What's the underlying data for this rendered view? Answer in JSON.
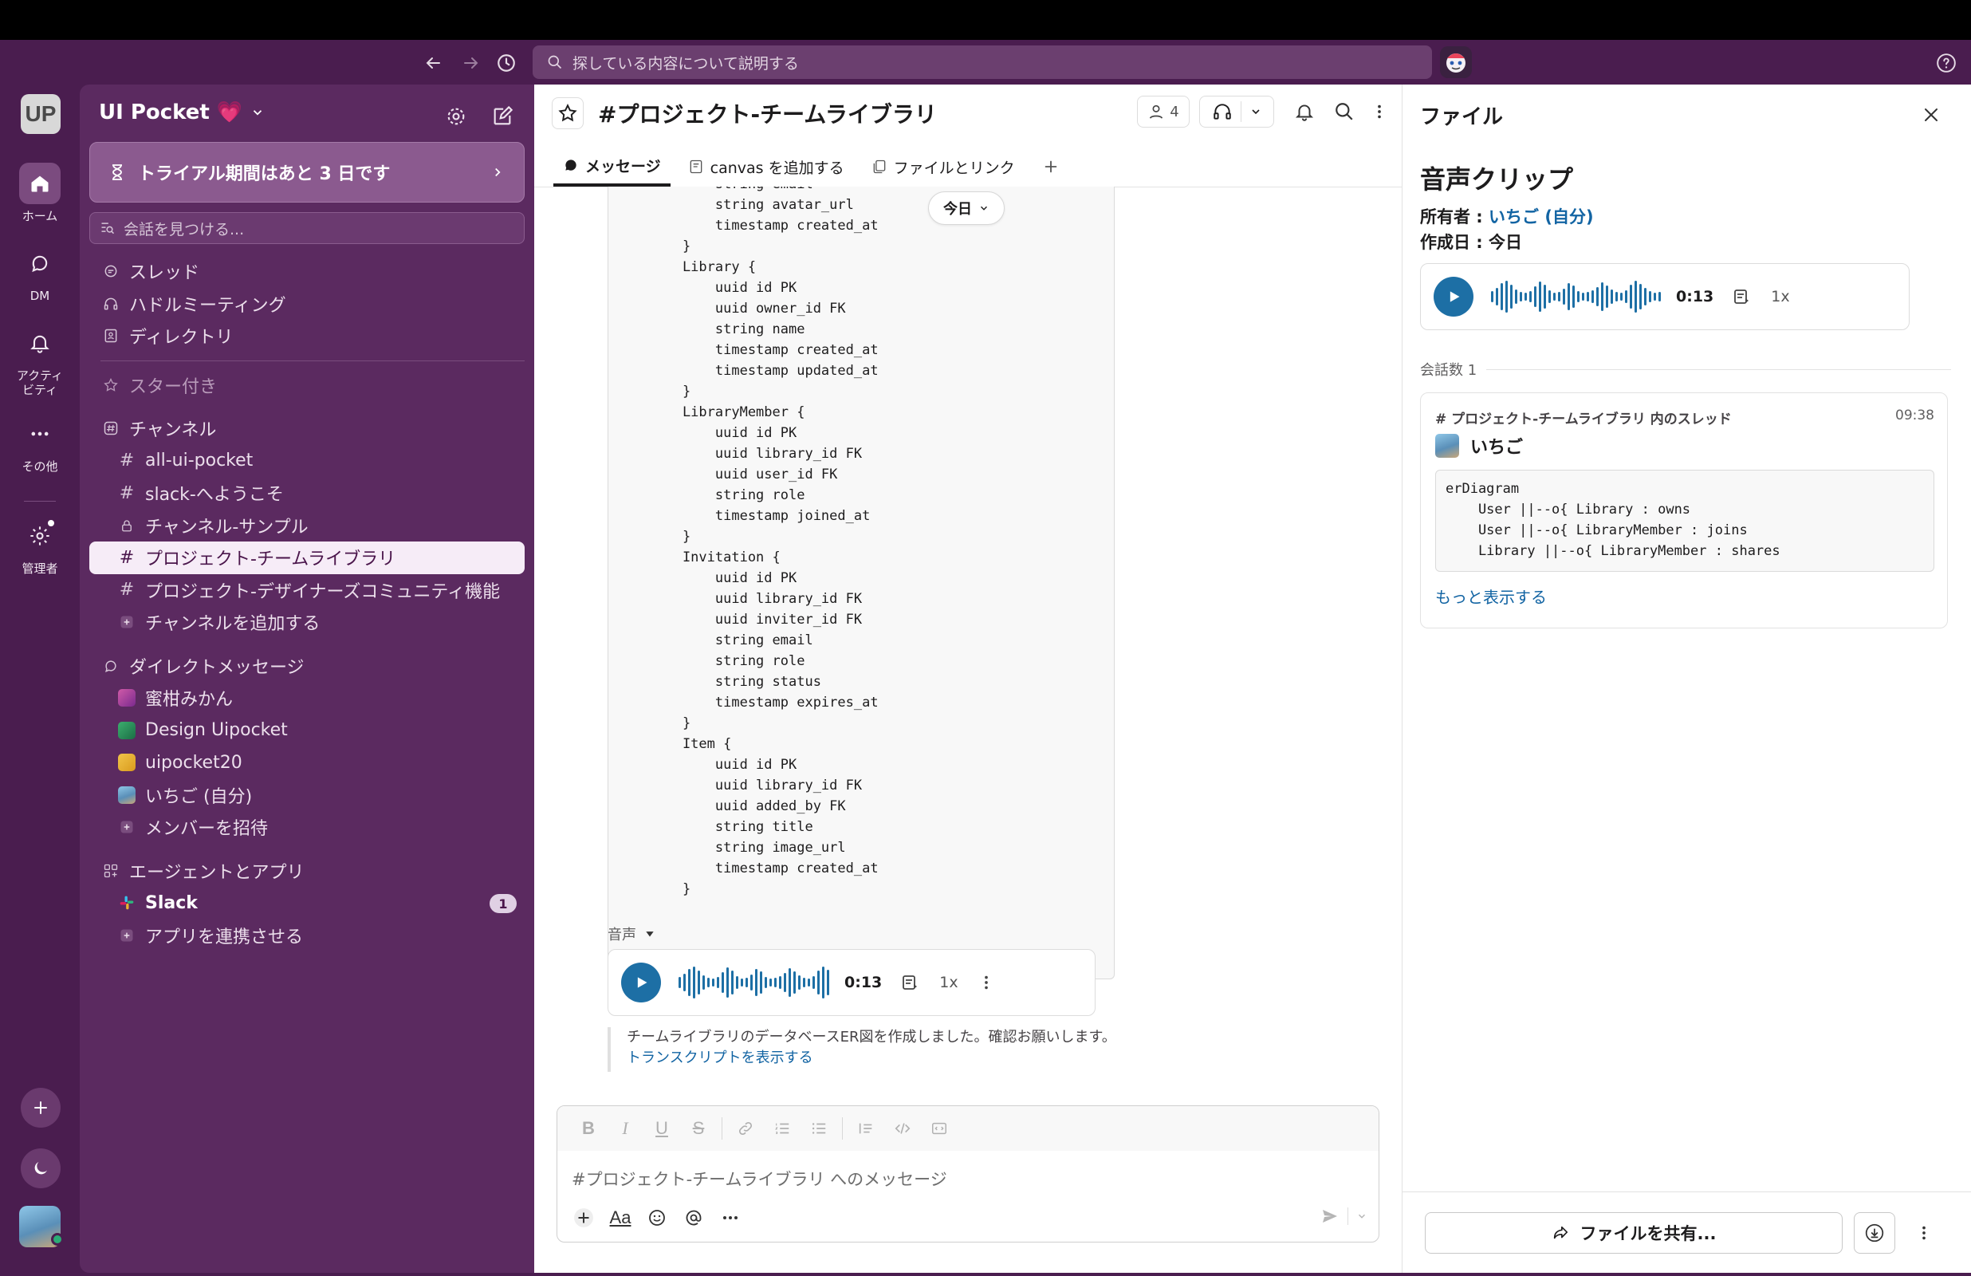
{
  "toolbar": {
    "search_placeholder": "探している内容について説明する"
  },
  "rail": {
    "workspace_initials": "UP",
    "items": [
      {
        "label": "ホーム"
      },
      {
        "label": "DM"
      },
      {
        "label": "アクティ\nビティ"
      },
      {
        "label": "その他"
      },
      {
        "label": "管理者"
      }
    ]
  },
  "sidebar": {
    "workspace_name": "UI Pocket 💗",
    "trial_text": "トライアル期間はあと 3 日です",
    "find_placeholder": "会話を見つける...",
    "nav": [
      "スレッド",
      "ハドルミーティング",
      "ディレクトリ"
    ],
    "starred_label": "スター付き",
    "channels_label": "チャンネル",
    "channels": [
      "all-ui-pocket",
      "slack-へようこそ",
      "チャンネル-サンプル",
      "プロジェクト-チームライブラリ",
      "プロジェクト-デザイナーズコミュニティ機能"
    ],
    "add_channel": "チャンネルを追加する",
    "dm_label": "ダイレクトメッセージ",
    "dms": [
      "蜜柑みかん",
      "Design Uipocket",
      "uipocket20",
      "いちご (自分)"
    ],
    "invite": "メンバーを招待",
    "apps_label": "エージェントとアプリ",
    "apps": [
      {
        "name": "Slack",
        "badge": "1"
      }
    ],
    "connect_app": "アプリを連携させる"
  },
  "channel": {
    "title": "#プロジェクト-チームライブラリ",
    "member_count": "4",
    "tabs": [
      "メッセージ",
      "canvas を追加する",
      "ファイルとリンク"
    ],
    "today_pill": "今日",
    "code": "        string email\n        string avatar_url\n        timestamp created_at\n    }\n    Library {\n        uuid id PK\n        uuid owner_id FK\n        string name\n        timestamp created_at\n        timestamp updated_at\n    }\n    LibraryMember {\n        uuid id PK\n        uuid library_id FK\n        uuid user_id FK\n        string role\n        timestamp joined_at\n    }\n    Invitation {\n        uuid id PK\n        uuid library_id FK\n        uuid inviter_id FK\n        string email\n        string role\n        string status\n        timestamp expires_at\n    }\n    Item {\n        uuid id PK\n        uuid library_id FK\n        uuid added_by FK\n        string title\n        string image_url\n        timestamp created_at\n    }",
    "audio_label": "音声",
    "audio_duration": "0:13",
    "audio_speed": "1x",
    "transcript_text": "チームライブラリのデータベースER図を作成しました。確認お願いします。",
    "transcript_link": "トランスクリプトを表示する",
    "composer_placeholder": "#プロジェクト-チームライブラリ へのメッセージ"
  },
  "panel": {
    "title": "ファイル",
    "file_name": "音声クリップ",
    "owner_label": "所有者 : ",
    "owner_value": "いちご (自分)",
    "created_label": "作成日 : 今日",
    "duration": "0:13",
    "speed": "1x",
    "conversation_count": "会話数 1",
    "thread_header": "# プロジェクト-チームライブラリ 内のスレッド",
    "thread_time": "09:38",
    "thread_user": "いちご",
    "thread_code": "erDiagram\n    User ||--o{ Library : owns\n    User ||--o{ LibraryMember : joins\n    Library ||--o{ LibraryMember : shares",
    "show_more": "もっと表示する",
    "share_button": "ファイルを共有..."
  },
  "colors": {
    "frame": "#4a1d4f",
    "sidebar": "#5b2a60",
    "accent_blue": "#1d6fa5",
    "link": "#1264a3"
  }
}
